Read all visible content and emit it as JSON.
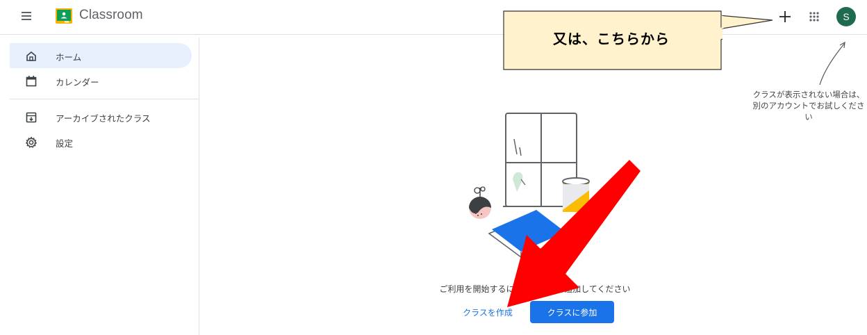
{
  "header": {
    "app_title": "Classroom",
    "menu_icon": "hamburger-menu-icon",
    "logo_icon": "classroom-logo-icon",
    "create_icon": "plus-icon",
    "apps_icon": "google-apps-icon",
    "avatar_initial": "S",
    "avatar_color": "#1e6b4e"
  },
  "sidebar": {
    "items": [
      {
        "label": "ホーム",
        "icon": "home-icon",
        "active": true
      },
      {
        "label": "カレンダー",
        "icon": "calendar-icon",
        "active": false
      },
      {
        "label": "アーカイブされたクラス",
        "icon": "archive-icon",
        "active": false
      },
      {
        "label": "設定",
        "icon": "settings-gear-icon",
        "active": false
      }
    ]
  },
  "main": {
    "empty_message": "ご利用を開始するには、クラスを追加してください",
    "create_class_label": "クラスを作成",
    "join_class_label": "クラスに参加"
  },
  "annotation": {
    "callout_text": "又は、こちらから",
    "hint_text": "クラスが表示されない場合は、別のアカウントでお試しください"
  },
  "colors": {
    "accent": "#1a73e8",
    "active_nav_bg": "#e8f0fe",
    "callout_bg": "#fff2cc",
    "arrow": "#ff0000"
  }
}
